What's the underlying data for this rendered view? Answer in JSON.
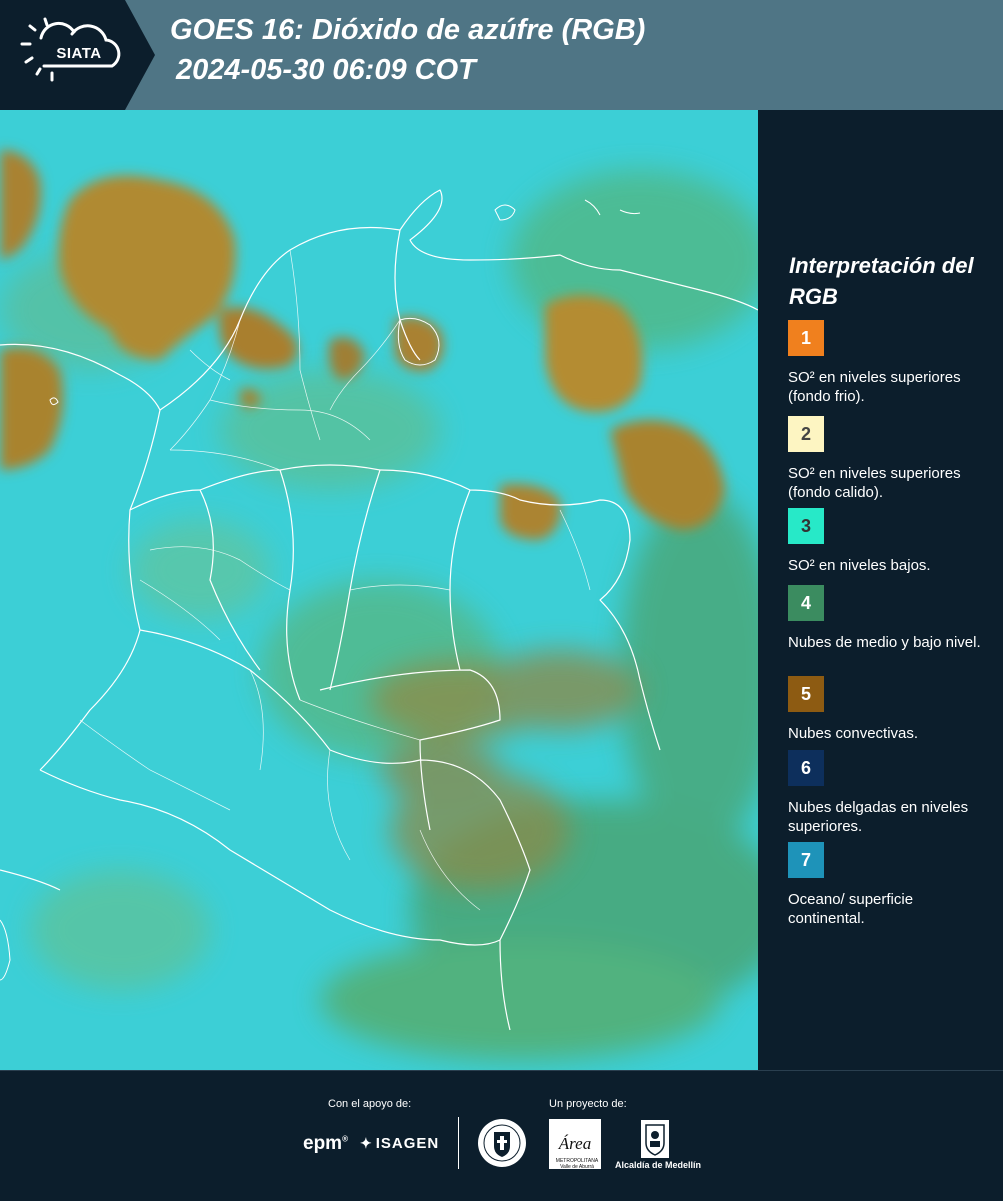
{
  "header": {
    "logo_text": "SIATA",
    "title_line_1": "GOES 16: Dióxido de azúfre (RGB)",
    "title_line_2": "2024-05-30 06:09 COT"
  },
  "map": {
    "base_color": "#3ccfd6",
    "boundary_color": "#ffffff"
  },
  "legend": {
    "title": "Interpretación del RGB",
    "items": [
      {
        "number": "1",
        "color": "#f0801e",
        "number_color": "#ffffff",
        "description": "SO² en niveles superiores (fondo frio)."
      },
      {
        "number": "2",
        "color": "#fdf5c2",
        "number_color": "#444444",
        "description": "SO² en niveles superiores (fondo calido)."
      },
      {
        "number": "3",
        "color": "#27e9c8",
        "number_color": "#333333",
        "description": "SO² en niveles bajos."
      },
      {
        "number": "4",
        "color": "#3b8c60",
        "number_color": "#ffffff",
        "description": "Nubes de medio y bajo nivel."
      },
      {
        "number": "5",
        "color": "#8d5b12",
        "number_color": "#ffffff",
        "description": "Nubes convectivas."
      },
      {
        "number": "6",
        "color": "#0d2f5c",
        "number_color": "#ffffff",
        "description": "Nubes delgadas en niveles superiores."
      },
      {
        "number": "7",
        "color": "#1e93b9",
        "number_color": "#ffffff",
        "description": "Oceano/ superficie continental."
      }
    ]
  },
  "footer": {
    "support_caption": "Con el apoyo de:",
    "project_caption": "Un proyecto de:",
    "epm_logo": "epm",
    "isagen_logo": "ISAGEN",
    "area_logo": "Área",
    "area_caption": "METROPOLITANA Valle de Aburrá",
    "alcaldia_label": "Alcaldía de Medellín"
  }
}
